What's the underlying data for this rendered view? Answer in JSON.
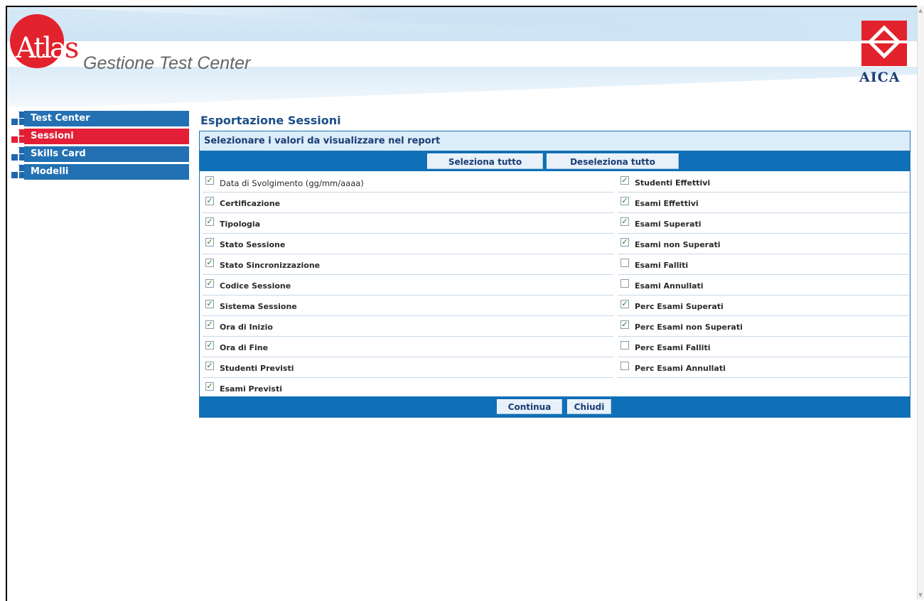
{
  "header": {
    "logo_text_a": "At",
    "logo_text_b": "la",
    "logo_text_c": "s",
    "app_title": "Gestione Test Center",
    "partner_name": "AICA"
  },
  "sidebar": {
    "items": [
      {
        "label": "Test Center",
        "active": false
      },
      {
        "label": "Sessioni",
        "active": true
      },
      {
        "label": "Skills Card",
        "active": false
      },
      {
        "label": "Modelli",
        "active": false
      }
    ]
  },
  "main": {
    "title": "Esportazione Sessioni",
    "panel_heading": "Selezionare i valori da visualizzare nel report",
    "select_all_label": "Seleziona tutto",
    "deselect_all_label": "Deseleziona tutto",
    "left_options": [
      {
        "label": "Data di Svolgimento (gg/mm/aaaa)",
        "checked": true
      },
      {
        "label": "Certificazione",
        "checked": true
      },
      {
        "label": "Tipologia",
        "checked": true
      },
      {
        "label": "Stato Sessione",
        "checked": true
      },
      {
        "label": "Stato Sincronizzazione",
        "checked": true
      },
      {
        "label": "Codice Sessione",
        "checked": true
      },
      {
        "label": "Sistema Sessione",
        "checked": true
      },
      {
        "label": "Ora di Inizio",
        "checked": true
      },
      {
        "label": "Ora di Fine",
        "checked": true
      },
      {
        "label": "Studenti Previsti",
        "checked": true
      },
      {
        "label": "Esami Previsti",
        "checked": true
      }
    ],
    "right_options": [
      {
        "label": "Studenti Effettivi",
        "checked": true
      },
      {
        "label": "Esami Effettivi",
        "checked": true
      },
      {
        "label": "Esami Superati",
        "checked": true
      },
      {
        "label": "Esami non Superati",
        "checked": true
      },
      {
        "label": "Esami Falliti",
        "checked": false
      },
      {
        "label": "Esami Annullati",
        "checked": false
      },
      {
        "label": "Perc Esami Superati",
        "checked": true
      },
      {
        "label": "Perc Esami non Superati",
        "checked": true
      },
      {
        "label": "Perc Esami Falliti",
        "checked": false
      },
      {
        "label": "Perc Esami Annullati",
        "checked": false
      }
    ],
    "continue_label": "Continua",
    "close_label": "Chiudi"
  },
  "colors": {
    "nav_blue": "#2371b3",
    "nav_active_red": "#e21f36",
    "toolbar_blue": "#0f70b7",
    "check_green": "#1f7e22"
  }
}
